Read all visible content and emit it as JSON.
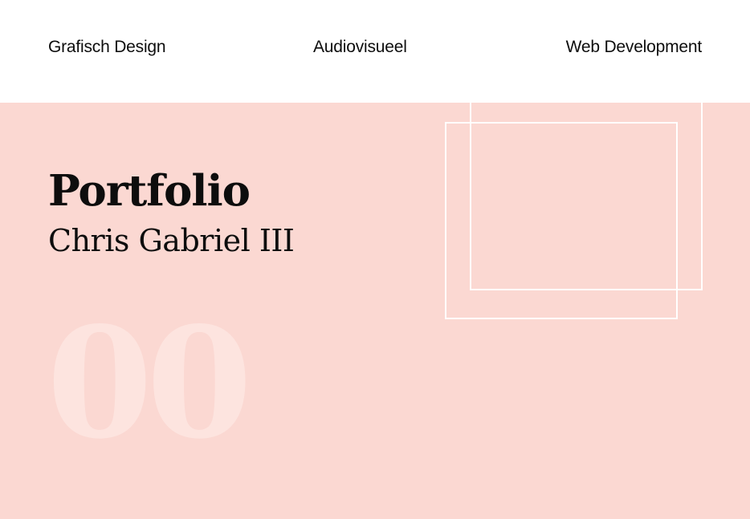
{
  "nav": {
    "items": [
      {
        "label": "Grafisch Design"
      },
      {
        "label": "Audiovisueel"
      },
      {
        "label": "Web Development"
      }
    ]
  },
  "hero": {
    "title": "Portfolio",
    "subtitle": "Chris Gabriel III",
    "number": "00"
  },
  "colors": {
    "background": "#ffffff",
    "hero_background": "#fbd8d2",
    "text": "#0d0d0d",
    "frame": "#ffffff",
    "number": "#fde4df"
  }
}
